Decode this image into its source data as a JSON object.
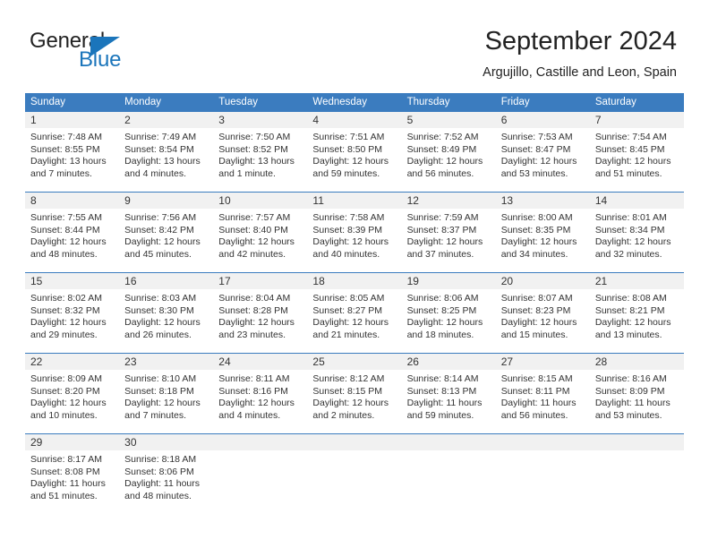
{
  "brand": {
    "name_part1": "General",
    "name_part2": "Blue"
  },
  "header": {
    "title": "September 2024",
    "location": "Argujillo, Castille and Leon, Spain"
  },
  "colors": {
    "header_blue": "#3b7cbf",
    "brand_blue": "#1b75bb",
    "day_band_gray": "#f1f1f1",
    "text": "#333333"
  },
  "weekdays": [
    "Sunday",
    "Monday",
    "Tuesday",
    "Wednesday",
    "Thursday",
    "Friday",
    "Saturday"
  ],
  "weeks": [
    [
      {
        "day": "1",
        "sunrise": "Sunrise: 7:48 AM",
        "sunset": "Sunset: 8:55 PM",
        "daylight1": "Daylight: 13 hours",
        "daylight2": "and 7 minutes."
      },
      {
        "day": "2",
        "sunrise": "Sunrise: 7:49 AM",
        "sunset": "Sunset: 8:54 PM",
        "daylight1": "Daylight: 13 hours",
        "daylight2": "and 4 minutes."
      },
      {
        "day": "3",
        "sunrise": "Sunrise: 7:50 AM",
        "sunset": "Sunset: 8:52 PM",
        "daylight1": "Daylight: 13 hours",
        "daylight2": "and 1 minute."
      },
      {
        "day": "4",
        "sunrise": "Sunrise: 7:51 AM",
        "sunset": "Sunset: 8:50 PM",
        "daylight1": "Daylight: 12 hours",
        "daylight2": "and 59 minutes."
      },
      {
        "day": "5",
        "sunrise": "Sunrise: 7:52 AM",
        "sunset": "Sunset: 8:49 PM",
        "daylight1": "Daylight: 12 hours",
        "daylight2": "and 56 minutes."
      },
      {
        "day": "6",
        "sunrise": "Sunrise: 7:53 AM",
        "sunset": "Sunset: 8:47 PM",
        "daylight1": "Daylight: 12 hours",
        "daylight2": "and 53 minutes."
      },
      {
        "day": "7",
        "sunrise": "Sunrise: 7:54 AM",
        "sunset": "Sunset: 8:45 PM",
        "daylight1": "Daylight: 12 hours",
        "daylight2": "and 51 minutes."
      }
    ],
    [
      {
        "day": "8",
        "sunrise": "Sunrise: 7:55 AM",
        "sunset": "Sunset: 8:44 PM",
        "daylight1": "Daylight: 12 hours",
        "daylight2": "and 48 minutes."
      },
      {
        "day": "9",
        "sunrise": "Sunrise: 7:56 AM",
        "sunset": "Sunset: 8:42 PM",
        "daylight1": "Daylight: 12 hours",
        "daylight2": "and 45 minutes."
      },
      {
        "day": "10",
        "sunrise": "Sunrise: 7:57 AM",
        "sunset": "Sunset: 8:40 PM",
        "daylight1": "Daylight: 12 hours",
        "daylight2": "and 42 minutes."
      },
      {
        "day": "11",
        "sunrise": "Sunrise: 7:58 AM",
        "sunset": "Sunset: 8:39 PM",
        "daylight1": "Daylight: 12 hours",
        "daylight2": "and 40 minutes."
      },
      {
        "day": "12",
        "sunrise": "Sunrise: 7:59 AM",
        "sunset": "Sunset: 8:37 PM",
        "daylight1": "Daylight: 12 hours",
        "daylight2": "and 37 minutes."
      },
      {
        "day": "13",
        "sunrise": "Sunrise: 8:00 AM",
        "sunset": "Sunset: 8:35 PM",
        "daylight1": "Daylight: 12 hours",
        "daylight2": "and 34 minutes."
      },
      {
        "day": "14",
        "sunrise": "Sunrise: 8:01 AM",
        "sunset": "Sunset: 8:34 PM",
        "daylight1": "Daylight: 12 hours",
        "daylight2": "and 32 minutes."
      }
    ],
    [
      {
        "day": "15",
        "sunrise": "Sunrise: 8:02 AM",
        "sunset": "Sunset: 8:32 PM",
        "daylight1": "Daylight: 12 hours",
        "daylight2": "and 29 minutes."
      },
      {
        "day": "16",
        "sunrise": "Sunrise: 8:03 AM",
        "sunset": "Sunset: 8:30 PM",
        "daylight1": "Daylight: 12 hours",
        "daylight2": "and 26 minutes."
      },
      {
        "day": "17",
        "sunrise": "Sunrise: 8:04 AM",
        "sunset": "Sunset: 8:28 PM",
        "daylight1": "Daylight: 12 hours",
        "daylight2": "and 23 minutes."
      },
      {
        "day": "18",
        "sunrise": "Sunrise: 8:05 AM",
        "sunset": "Sunset: 8:27 PM",
        "daylight1": "Daylight: 12 hours",
        "daylight2": "and 21 minutes."
      },
      {
        "day": "19",
        "sunrise": "Sunrise: 8:06 AM",
        "sunset": "Sunset: 8:25 PM",
        "daylight1": "Daylight: 12 hours",
        "daylight2": "and 18 minutes."
      },
      {
        "day": "20",
        "sunrise": "Sunrise: 8:07 AM",
        "sunset": "Sunset: 8:23 PM",
        "daylight1": "Daylight: 12 hours",
        "daylight2": "and 15 minutes."
      },
      {
        "day": "21",
        "sunrise": "Sunrise: 8:08 AM",
        "sunset": "Sunset: 8:21 PM",
        "daylight1": "Daylight: 12 hours",
        "daylight2": "and 13 minutes."
      }
    ],
    [
      {
        "day": "22",
        "sunrise": "Sunrise: 8:09 AM",
        "sunset": "Sunset: 8:20 PM",
        "daylight1": "Daylight: 12 hours",
        "daylight2": "and 10 minutes."
      },
      {
        "day": "23",
        "sunrise": "Sunrise: 8:10 AM",
        "sunset": "Sunset: 8:18 PM",
        "daylight1": "Daylight: 12 hours",
        "daylight2": "and 7 minutes."
      },
      {
        "day": "24",
        "sunrise": "Sunrise: 8:11 AM",
        "sunset": "Sunset: 8:16 PM",
        "daylight1": "Daylight: 12 hours",
        "daylight2": "and 4 minutes."
      },
      {
        "day": "25",
        "sunrise": "Sunrise: 8:12 AM",
        "sunset": "Sunset: 8:15 PM",
        "daylight1": "Daylight: 12 hours",
        "daylight2": "and 2 minutes."
      },
      {
        "day": "26",
        "sunrise": "Sunrise: 8:14 AM",
        "sunset": "Sunset: 8:13 PM",
        "daylight1": "Daylight: 11 hours",
        "daylight2": "and 59 minutes."
      },
      {
        "day": "27",
        "sunrise": "Sunrise: 8:15 AM",
        "sunset": "Sunset: 8:11 PM",
        "daylight1": "Daylight: 11 hours",
        "daylight2": "and 56 minutes."
      },
      {
        "day": "28",
        "sunrise": "Sunrise: 8:16 AM",
        "sunset": "Sunset: 8:09 PM",
        "daylight1": "Daylight: 11 hours",
        "daylight2": "and 53 minutes."
      }
    ],
    [
      {
        "day": "29",
        "sunrise": "Sunrise: 8:17 AM",
        "sunset": "Sunset: 8:08 PM",
        "daylight1": "Daylight: 11 hours",
        "daylight2": "and 51 minutes."
      },
      {
        "day": "30",
        "sunrise": "Sunrise: 8:18 AM",
        "sunset": "Sunset: 8:06 PM",
        "daylight1": "Daylight: 11 hours",
        "daylight2": "and 48 minutes."
      },
      {
        "day": "",
        "sunrise": "",
        "sunset": "",
        "daylight1": "",
        "daylight2": ""
      },
      {
        "day": "",
        "sunrise": "",
        "sunset": "",
        "daylight1": "",
        "daylight2": ""
      },
      {
        "day": "",
        "sunrise": "",
        "sunset": "",
        "daylight1": "",
        "daylight2": ""
      },
      {
        "day": "",
        "sunrise": "",
        "sunset": "",
        "daylight1": "",
        "daylight2": ""
      },
      {
        "day": "",
        "sunrise": "",
        "sunset": "",
        "daylight1": "",
        "daylight2": ""
      }
    ]
  ]
}
